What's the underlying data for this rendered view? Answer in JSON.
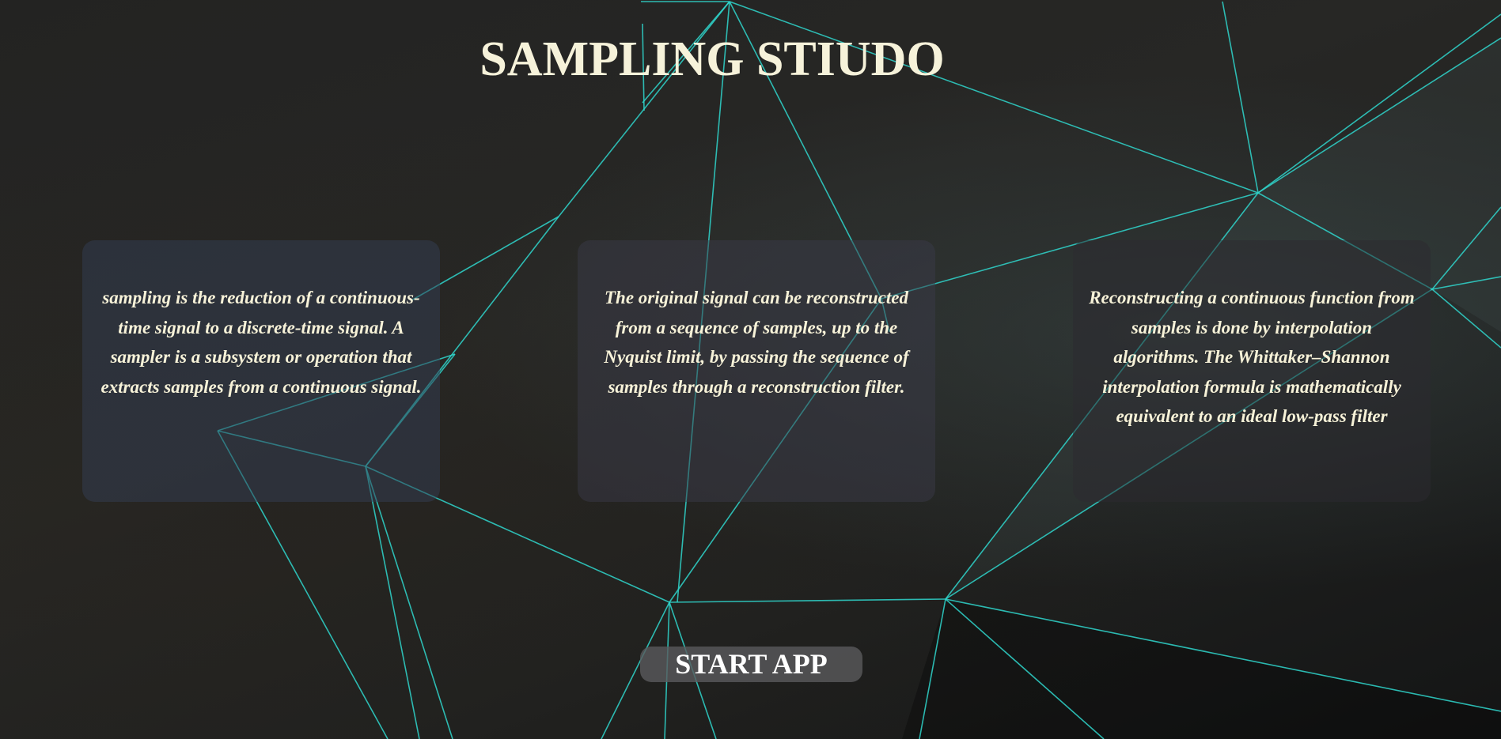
{
  "page": {
    "title": "SAMPLING STIUDO"
  },
  "cards": [
    {
      "text": "sampling is the reduction of a continuous-time signal to a discrete-time signal. A sampler is a subsystem or operation that extracts samples from a continuous signal."
    },
    {
      "text": "The original signal can be reconstructed from a sequence of samples, up to the Nyquist limit, by passing the sequence of samples through a reconstruction filter."
    },
    {
      "text": "Reconstructing a continuous function from samples is done by interpolation algorithms. The Whittaker–Shannon interpolation formula is mathematically equivalent to an ideal low-pass filter"
    }
  ],
  "actions": {
    "start_label": "START APP"
  },
  "colors": {
    "mesh_line": "#2fd6cc",
    "title_text": "#f6f2da",
    "card_text": "#f7f2d8",
    "button_bg": "#5a5a5c"
  }
}
